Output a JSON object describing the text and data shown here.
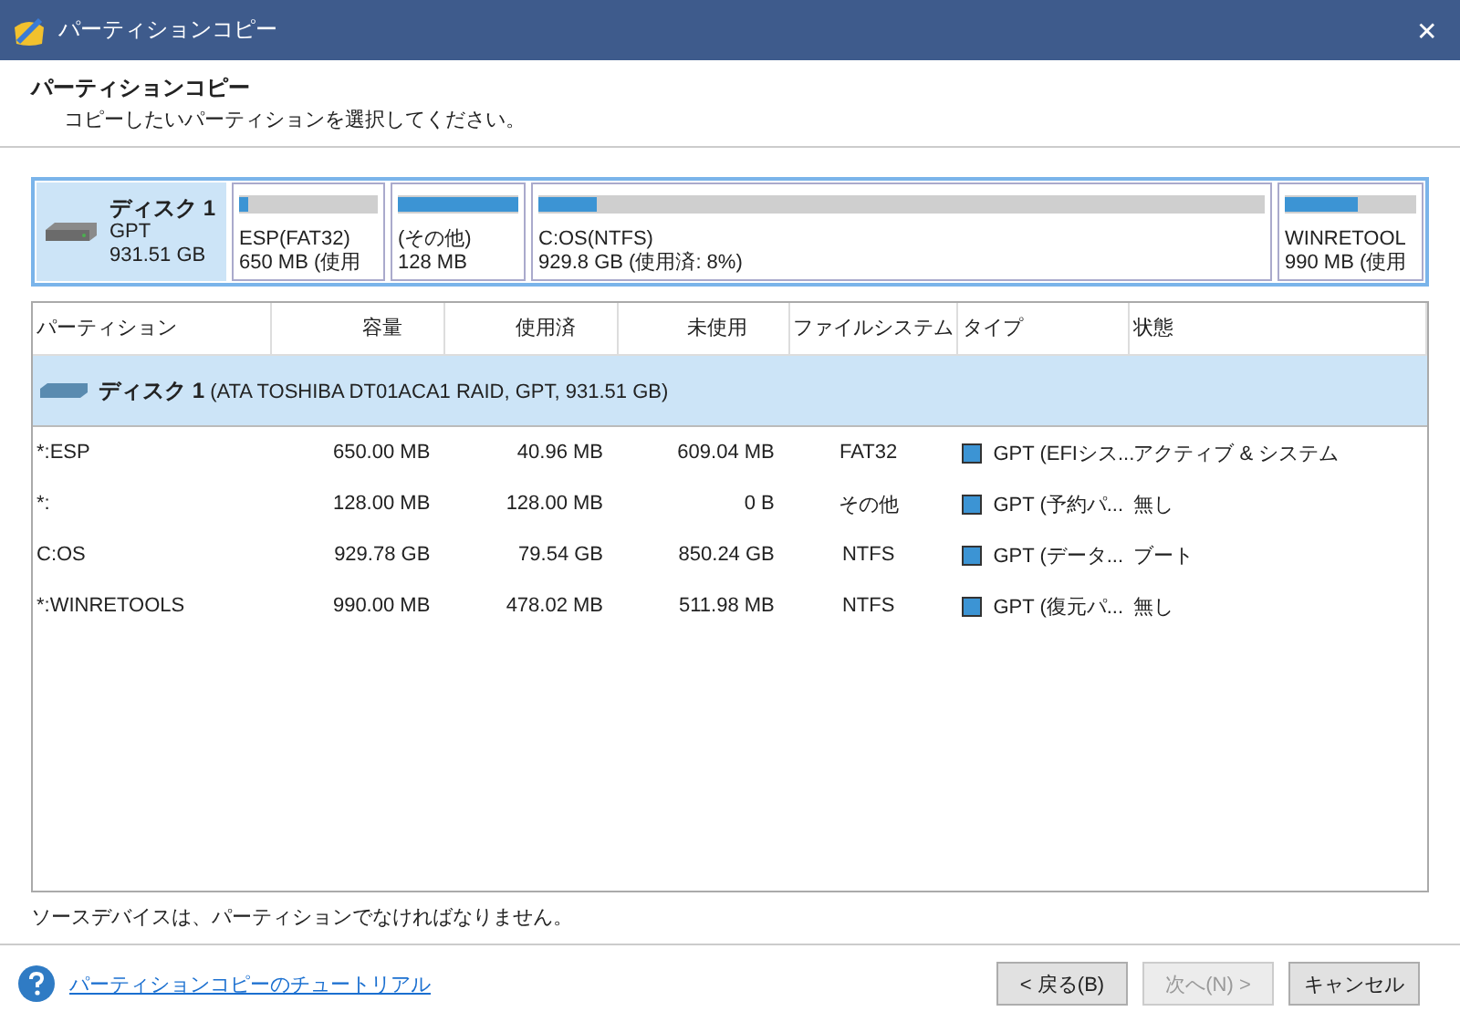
{
  "window": {
    "title": "パーティションコピー"
  },
  "header": {
    "title": "パーティションコピー",
    "subtitle": "コピーしたいパーティションを選択してください。"
  },
  "disk_map": {
    "disk": {
      "name": "ディスク 1",
      "scheme": "GPT",
      "size": "931.51 GB",
      "selected": true
    },
    "partitions": [
      {
        "label": "ESP(FAT32)",
        "detail": "650 MB (使用",
        "level": 0.06
      },
      {
        "label": "(その他)",
        "detail": "128 MB",
        "level": 1
      },
      {
        "label": "C:OS(NTFS)",
        "detail": "929.8 GB (使用済: 8%)",
        "level": 0.08
      },
      {
        "label": "WINRETOOL",
        "detail": "990 MB (使用",
        "level": 0.55
      }
    ]
  },
  "table": {
    "columns": [
      "パーティション",
      "容量",
      "使用済",
      "未使用",
      "ファイルシステム",
      "タイプ",
      "状態"
    ],
    "disk_row": {
      "name": "ディスク 1",
      "detail": "(ATA TOSHIBA DT01ACA1 RAID, GPT, 931.51 GB)",
      "selected": true
    },
    "rows": [
      {
        "partition": "*:ESP",
        "capacity": "650.00 MB",
        "used": "40.96 MB",
        "unused": "609.04 MB",
        "fs": "FAT32",
        "type": "GPT (EFIシス...",
        "status": "アクティブ & システム",
        "selected": false
      },
      {
        "partition": "*:",
        "capacity": "128.00 MB",
        "used": "128.00 MB",
        "unused": "0 B",
        "fs": "その他",
        "type": "GPT (予約パ...",
        "status": "無し",
        "selected": false
      },
      {
        "partition": "C:OS",
        "capacity": "929.78 GB",
        "used": "79.54 GB",
        "unused": "850.24 GB",
        "fs": "NTFS",
        "type": "GPT (データ...",
        "status": "ブート",
        "selected": false
      },
      {
        "partition": "*:WINRETOOLS",
        "capacity": "990.00 MB",
        "used": "478.02 MB",
        "unused": "511.98 MB",
        "fs": "NTFS",
        "type": "GPT (復元パ...",
        "status": "無し",
        "selected": false
      }
    ]
  },
  "message": "ソースデバイスは、パーティションでなければなりません。",
  "footer": {
    "help_link": "パーティションコピーのチュートリアル",
    "buttons": [
      {
        "label": "< 戻る(B)",
        "disabled": false
      },
      {
        "label": "次へ(N) >",
        "disabled": true
      },
      {
        "label": "キャンセル",
        "disabled": false
      }
    ]
  },
  "close": "✕"
}
